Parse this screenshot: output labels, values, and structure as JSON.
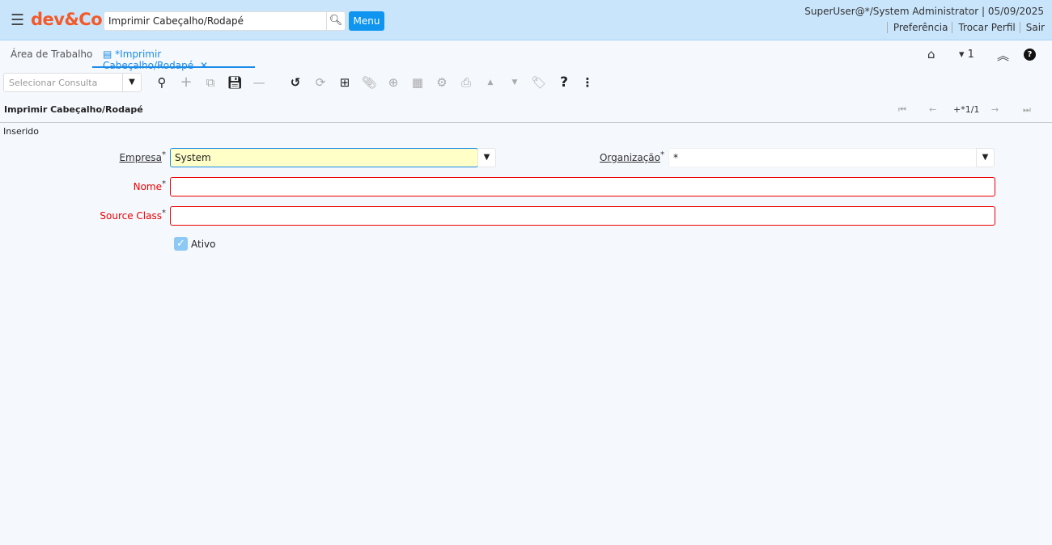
{
  "header": {
    "logo": "dev&Co.",
    "search_value": "Imprimir Cabeçalho/Rodapé",
    "menu_label": "Menu",
    "user_info": "SuperUser@*/System Administrator | 05/09/2025",
    "links": [
      "Preferência",
      "Trocar Perfil",
      "Sair"
    ]
  },
  "tabs": [
    {
      "label": "Área de Trabalho"
    },
    {
      "label": "*Imprimir Cabeçalho/Rodapé"
    }
  ],
  "right_controls": {
    "count": "1"
  },
  "toolbar": {
    "query_placeholder": "Selecionar Consulta"
  },
  "window": {
    "title": "Imprimir Cabeçalho/Rodapé",
    "record_nav": "+*1/1",
    "status": "Inserido"
  },
  "form": {
    "empresa": {
      "label": "Empresa",
      "value": "System"
    },
    "organizacao": {
      "label": "Organização",
      "value": "*"
    },
    "nome": {
      "label": "Nome",
      "value": ""
    },
    "source_class": {
      "label": "Source Class",
      "value": ""
    },
    "ativo": {
      "label": "Ativo",
      "checked": true
    },
    "required_mark": "*"
  },
  "colors": {
    "header_bg": "#c9e5fb",
    "accent": "#1a8be8",
    "logo": "#f25a29",
    "required": "#e00000",
    "highlight": "#ffffc8"
  }
}
